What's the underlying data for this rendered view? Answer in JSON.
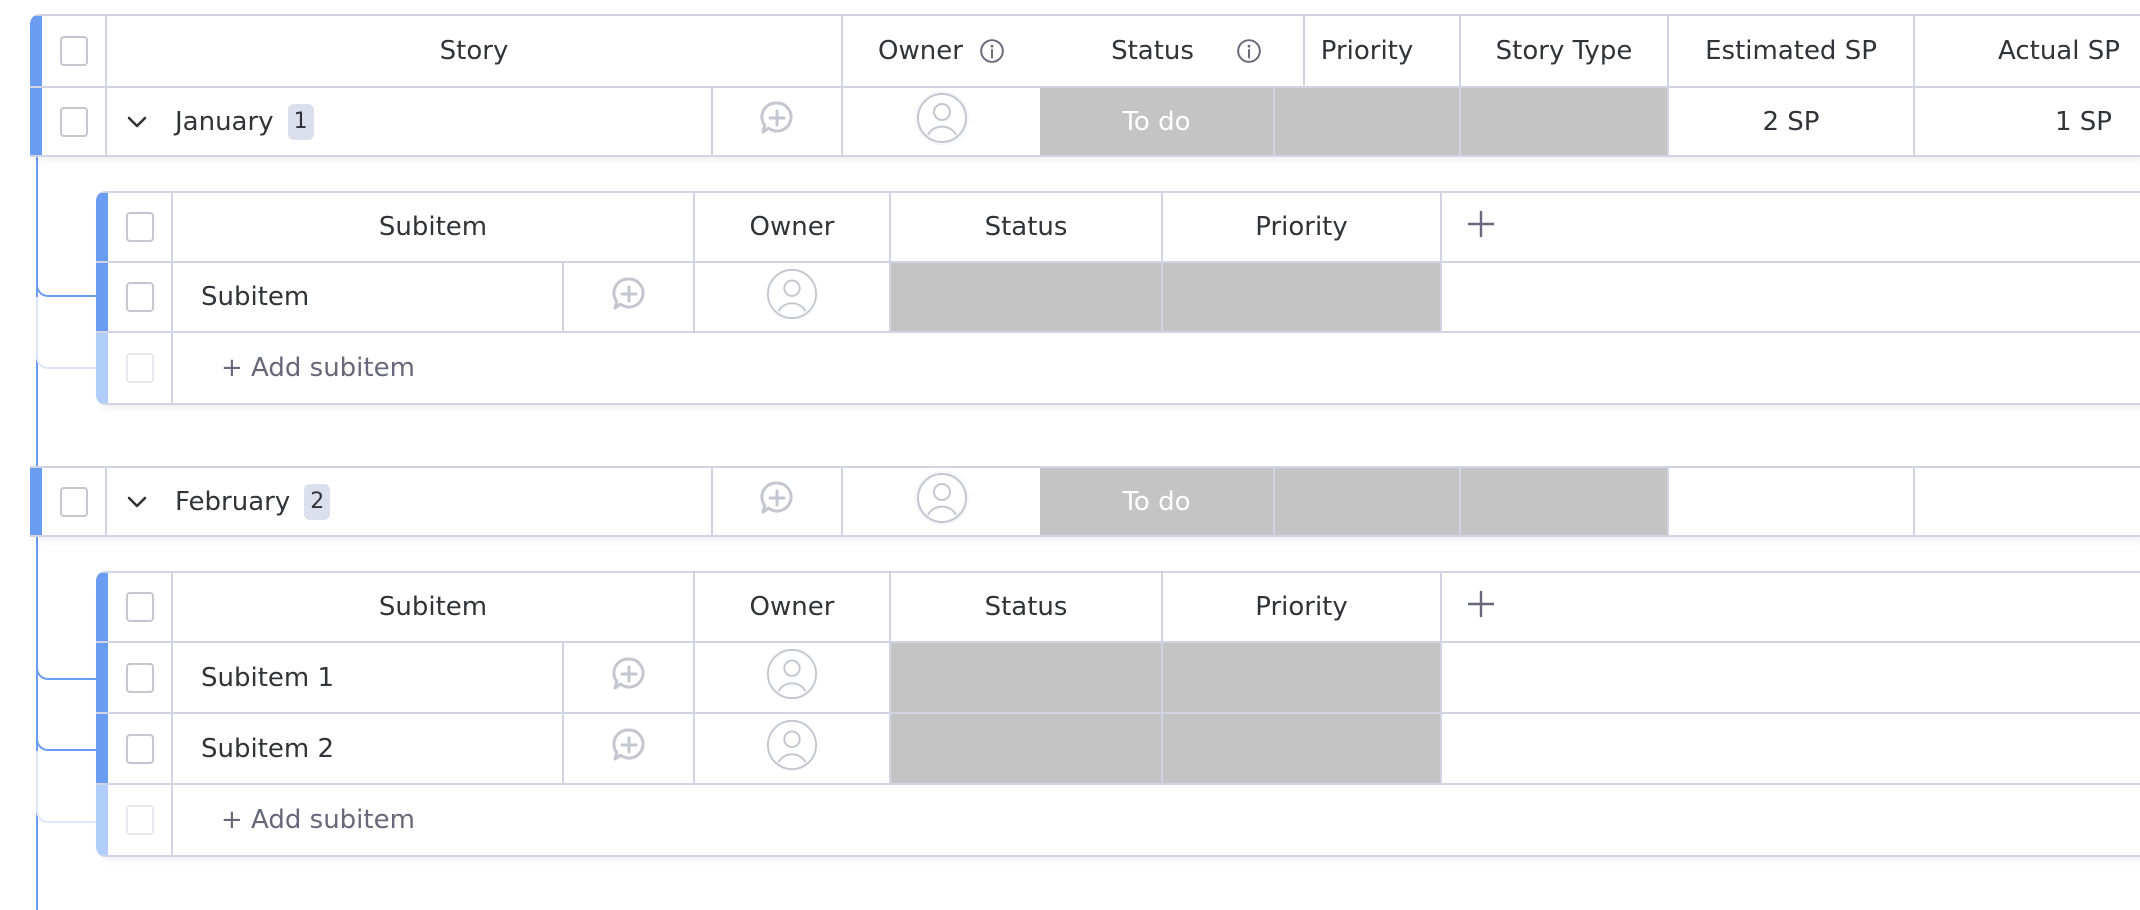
{
  "main_table": {
    "columns": [
      {
        "key": "select",
        "label": ""
      },
      {
        "key": "story",
        "label": "Story"
      },
      {
        "key": "owner",
        "label": "Owner",
        "info": true
      },
      {
        "key": "status",
        "label": "Status",
        "info": true
      },
      {
        "key": "priority",
        "label": "Priority"
      },
      {
        "key": "story_type",
        "label": "Story Type"
      },
      {
        "key": "estimated_sp",
        "label": "Estimated SP"
      },
      {
        "key": "actual_sp",
        "label": "Actual SP"
      }
    ],
    "accent_color": "#6a9cf2",
    "empty_cell_color": "#c4c4c4"
  },
  "groups": [
    {
      "name": "January",
      "subitem_count": "1",
      "owner": "unassigned",
      "status": "To do",
      "priority": "",
      "story_type": "",
      "estimated_sp": "2 SP",
      "actual_sp": "1 SP",
      "subtable": {
        "columns": [
          "Subitem",
          "Owner",
          "Status",
          "Priority"
        ],
        "add_column_icon": "plus-icon",
        "rows": [
          {
            "name": "Subitem",
            "owner": "unassigned",
            "status": "",
            "priority": ""
          }
        ],
        "add_label": "+ Add subitem"
      }
    },
    {
      "name": "February",
      "subitem_count": "2",
      "owner": "unassigned",
      "status": "To do",
      "priority": "",
      "story_type": "",
      "estimated_sp": "",
      "actual_sp": "",
      "subtable": {
        "columns": [
          "Subitem",
          "Owner",
          "Status",
          "Priority"
        ],
        "add_column_icon": "plus-icon",
        "rows": [
          {
            "name": "Subitem 1",
            "owner": "unassigned",
            "status": "",
            "priority": ""
          },
          {
            "name": "Subitem 2",
            "owner": "unassigned",
            "status": "",
            "priority": ""
          }
        ],
        "add_label": "+ Add subitem"
      }
    }
  ]
}
